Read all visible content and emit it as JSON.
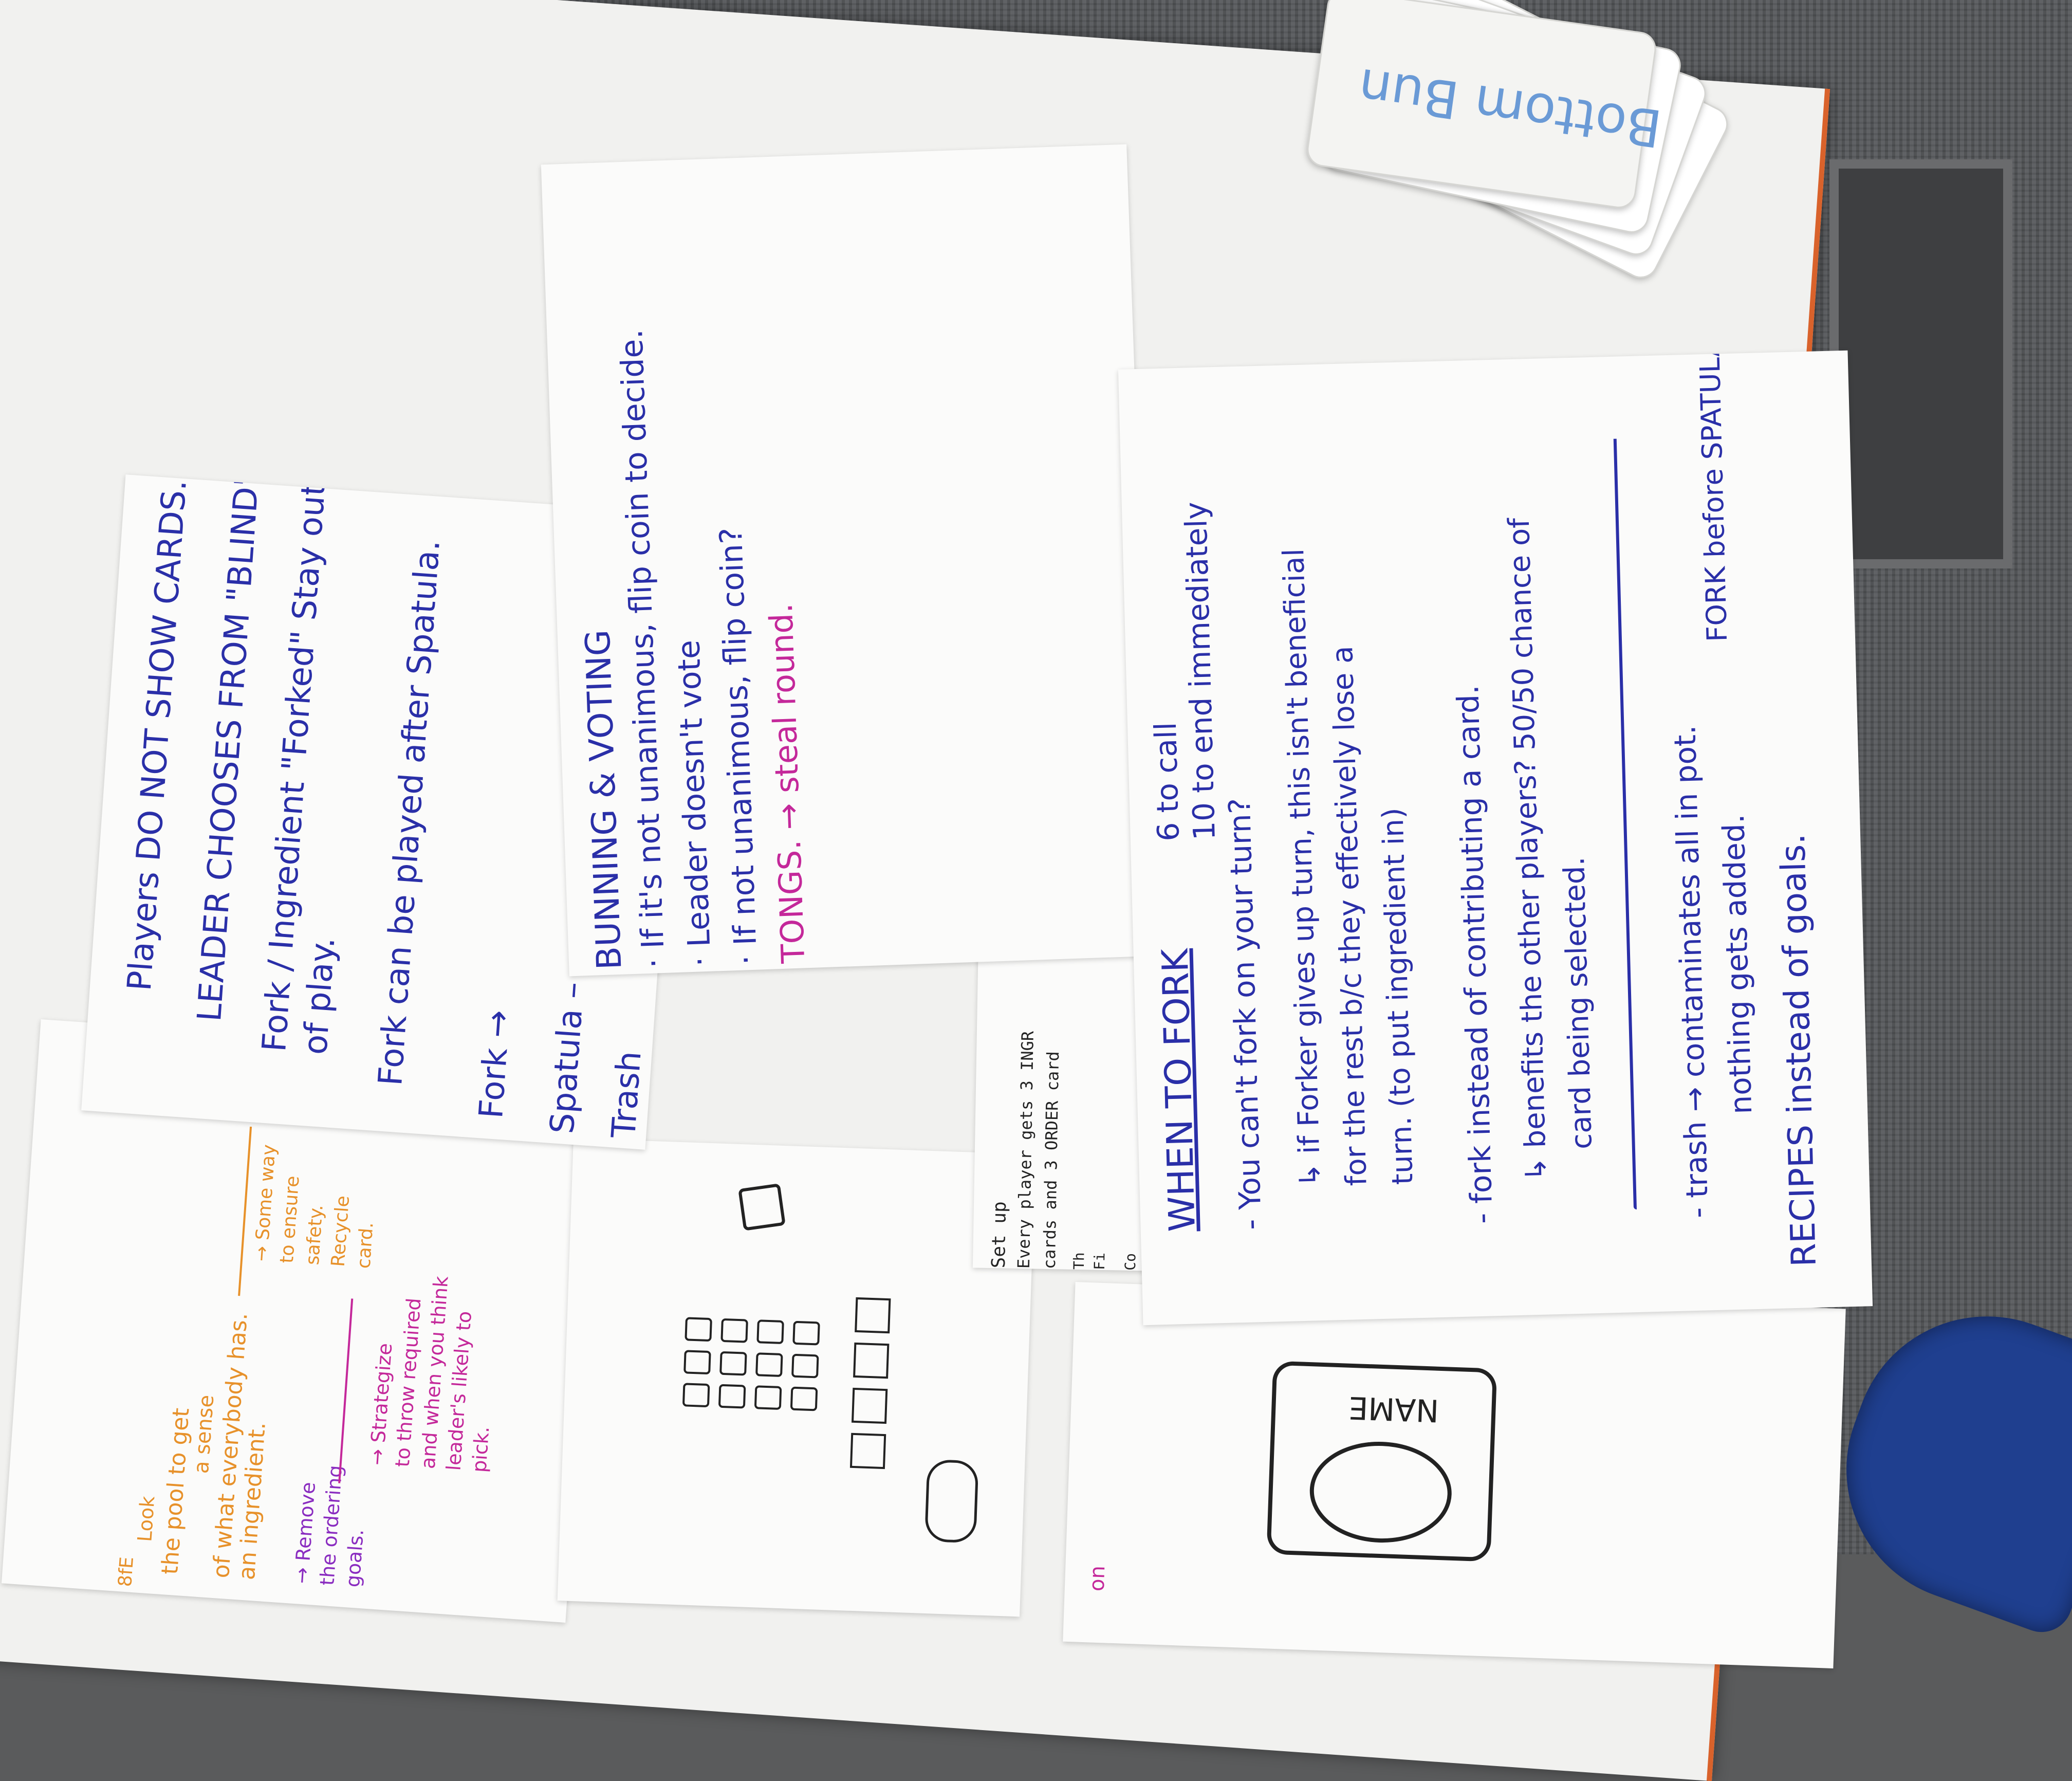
{
  "cards": {
    "top_card": "Bottom Bun"
  },
  "rules_sheet": {
    "line1": "Players DO NOT SHOW CARDS.",
    "line2": "LEADER CHOOSES FROM \"BLIND\".",
    "line3a": "Fork / Ingredient \"Forked\" Stay out",
    "line3b": "of play.",
    "line4": "Fork can be played after Spatula.",
    "line5": "Fork →",
    "line6": "Spatula –",
    "line7": "Trash"
  },
  "bunning_sheet": {
    "title": "BUNNING & VOTING",
    "item1": "· If it's not unanimous, flip coin to decide.",
    "item2": "· Leader doesn't vote",
    "item3": "· If not unanimous, flip coin?",
    "item4": "TONGS. → steal round."
  },
  "fork_sheet": {
    "title": "WHEN TO FORK",
    "timing1": "6 to call",
    "timing2": "10 to end immediately",
    "b1": "- You can't fork on your turn?",
    "b2a": "↳ if Forker gives up turn, this isn't beneficial",
    "b2b": "for the rest b/c they effectively lose a",
    "b2c": "turn. (to put ingredient in)",
    "b3": "- fork instead of contributing a card.",
    "b4a": "↳ benefits the other players? 50/50 chance of",
    "b4b": "card being selected.",
    "b5a": "- trash → contaminates all in pot.",
    "b5b": "nothing gets added.",
    "b6": "RECIPES instead of goals.",
    "side": "FORK before SPATULA"
  },
  "setup_sheet": {
    "title": "Set up",
    "line1": "Every player gets 3 INGR",
    "line2": "cards and 3 ORDER card",
    "frag1": "Th",
    "frag2": "Fi",
    "frag3": "Co"
  },
  "orange_sheet": {
    "o1": "Look",
    "o2": "the pool to get",
    "o3": "a sense",
    "o4": "of what everybody has.",
    "o5": "an ingredient.",
    "o6": "→ Some way",
    "o7": "to ensure",
    "o8": "safety.",
    "o9": "Recycle",
    "o10": "card.",
    "p1": "→ Remove",
    "p2": "the ordering",
    "p3": "goals.",
    "p4": "→ Strategize",
    "p5": "to throw required",
    "p6": "and when you think",
    "p7": "leader's likely to",
    "p8": "pick.",
    "corner": "8fE"
  },
  "sketch_sheet": {
    "label": "NAME",
    "frag": "on"
  },
  "colors": {
    "ink_blue": "#2a2fa8",
    "ink_magenta": "#c4289a",
    "ink_orange": "#e7912a",
    "ink_purple": "#8a2cc0",
    "table_edge": "#d9622b",
    "card_text": "#6a9ad6"
  }
}
